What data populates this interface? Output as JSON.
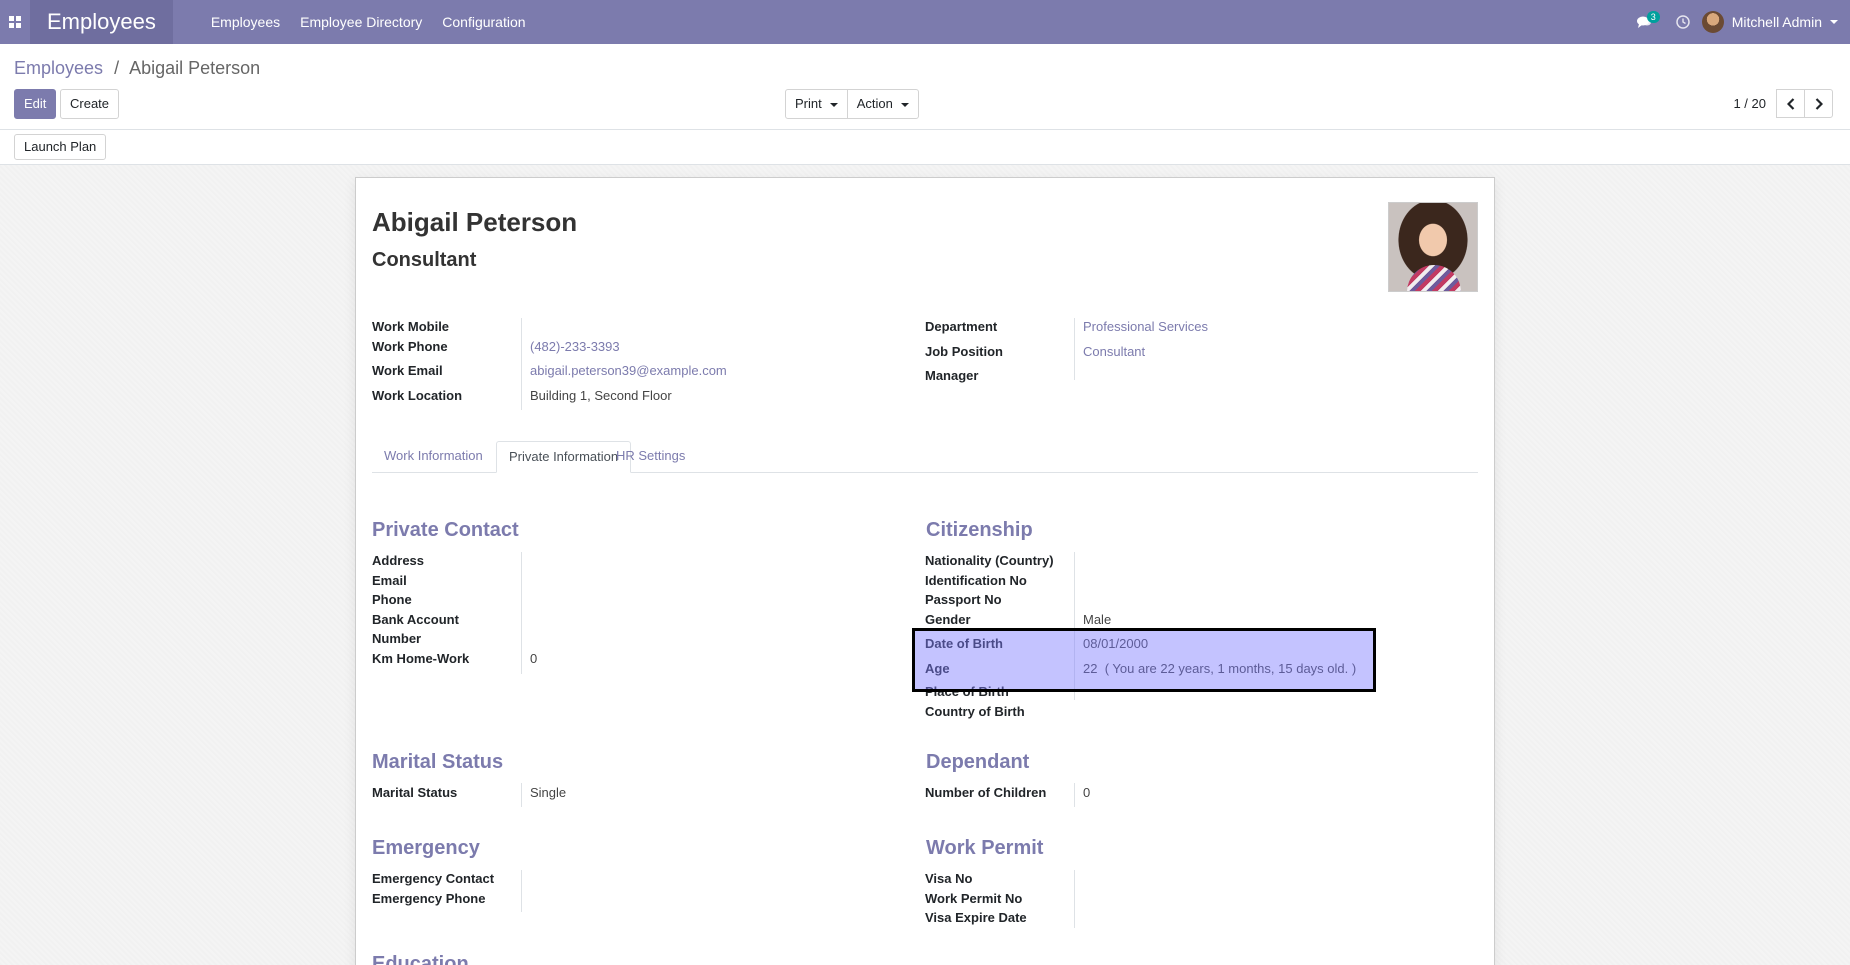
{
  "navbar": {
    "app_name": "Employees",
    "menu": [
      "Employees",
      "Employee Directory",
      "Configuration"
    ],
    "chat_count": "3",
    "user_name": "Mitchell Admin"
  },
  "breadcrumb": {
    "parent": "Employees",
    "separator": "/",
    "current": "Abigail Peterson"
  },
  "buttons": {
    "edit": "Edit",
    "create": "Create",
    "print": "Print",
    "action": "Action",
    "launch_plan": "Launch Plan"
  },
  "pager": {
    "value": "1 / 20"
  },
  "employee": {
    "name": "Abigail Peterson",
    "job_title": "Consultant",
    "fields_left": [
      {
        "label": "Work Mobile",
        "value": ""
      },
      {
        "label": "Work Phone",
        "value": "(482)-233-3393"
      },
      {
        "label": "Work Email",
        "value": "abigail.peterson39@example.com"
      },
      {
        "label": "Work Location",
        "value": "Building 1, Second Floor"
      }
    ],
    "fields_right": [
      {
        "label": "Department",
        "value": "Professional Services"
      },
      {
        "label": "Job Position",
        "value": "Consultant"
      },
      {
        "label": "Manager",
        "value": ""
      }
    ]
  },
  "tabs": [
    "Work Information",
    "Private Information",
    "HR Settings"
  ],
  "private_contact": {
    "title": "Private Contact",
    "address": "Address",
    "email": "Email",
    "phone": "Phone",
    "bank_1": "Bank Account",
    "bank_2": "Number",
    "km_label": "Km Home-Work",
    "km_value": "0"
  },
  "citizenship": {
    "title": "Citizenship",
    "nationality": "Nationality (Country)",
    "identification": "Identification No",
    "passport": "Passport No",
    "gender_label": "Gender",
    "gender_value": "Male",
    "dob_label": "Date of Birth",
    "dob_value": "08/01/2000",
    "age_label": "Age",
    "age_value": "22",
    "age_note": "( You are 22 years, 1 months, 15 days old. )",
    "place_of_birth": "Place of Birth",
    "country_of_birth": "Country of Birth"
  },
  "marital": {
    "title": "Marital Status",
    "label": "Marital Status",
    "value": "Single"
  },
  "dependant": {
    "title": "Dependant",
    "label": "Number of Children",
    "value": "0"
  },
  "emergency": {
    "title": "Emergency",
    "contact": "Emergency Contact",
    "phone": "Emergency Phone"
  },
  "work_permit": {
    "title": "Work Permit",
    "visa_no": "Visa No",
    "permit_no": "Work Permit No",
    "visa_expire": "Visa Expire Date"
  },
  "education": {
    "title": "Education"
  }
}
